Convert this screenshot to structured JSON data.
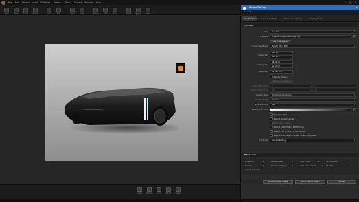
{
  "menu": [
    "File",
    "Edit",
    "Render",
    "Insert",
    "Selection",
    "Pattern",
    "Tools",
    "Shader",
    "Window",
    "Help"
  ],
  "toolbar": [
    "Open",
    "Save",
    "Import",
    "Render",
    "Undo",
    "Redo",
    "Move",
    "Scale",
    "Camera",
    "Light",
    "Env",
    "Output",
    "Render Queue",
    "Region"
  ],
  "dock": [
    "Library",
    "Material",
    "Scene",
    "Project",
    "Render"
  ],
  "panel": {
    "title": "Render Settings",
    "presets": "Presets",
    "tabs": [
      "File Output",
      "General Settings",
      "Raytracing Quality",
      "Display Output"
    ],
    "image_section": "Image",
    "metadata_section": "Metadata",
    "view_label": "View",
    "view_value": "Current",
    "filename_label": "Filename",
    "filename_value": "C:\\render\\snapshots\\image.png",
    "use_time_stamp": "Use Time Stamp",
    "image_size_label": "Image Size/Preset",
    "image_size_value": "SVGA | 800 x 600",
    "image_size_w": "800 px",
    "image_size_h": "600 px",
    "printing_size_w": "28.22 cm",
    "printing_size_h": "21.17 cm",
    "printing_size_label": "Printing Size",
    "image_size_px_label": "Image Size",
    "resolution_label": "Resolution",
    "resolution_value": "72 px / inch",
    "render_region": "Render Region",
    "use_current_region": "Use Current Region",
    "upper_left_corner": "Upper Left Corner",
    "lower_right_corner": "Lower Right Corner",
    "ulc_x": "0",
    "ulc_y": "0",
    "lrc_x": "800",
    "lrc_y": "600",
    "render_mode_label": "Render Mode",
    "render_mode_value": "Full Global Illumination",
    "render_quality_label": "Render Quality",
    "render_quality_value": "Custom",
    "supersampling_label": "Supersampling",
    "supersampling_value": "16x",
    "background_color_label": "Background Color",
    "tonemap_hdr": "Tonemap HDR",
    "export_alpha": "Export Alpha Channel",
    "premultiply_alpha": "Premultiply Alpha",
    "export_hdr": "Export 32Bit HDR or EXR Format",
    "export_exr": "Export EXR in 16-Bit Float Format",
    "export_layers": "Export Multi-Layer EXR/PSD for Render Passes",
    "icc_profile_label": "ICC Profile",
    "icc_profile_value": "Current Settings",
    "stats": {
      "viewpoints_label": "Viewpoints:",
      "viewpoints": "1",
      "renderpasses_label": "Renderpasses:",
      "renderpasses": "0",
      "variant_sets_label": "Variant Sets:",
      "variant_sets": "0",
      "total_renders_label": "Total Renders:",
      "total_renders": "1",
      "frames_label": "Frames:",
      "frames": "1",
      "renderpass_images_label": "Renderpass Images:",
      "renderpass_images": "0",
      "variant_set_renders_label": "Variant Set Renders:",
      "variant_set_renders": "0",
      "total_files_label": "Total Files:",
      "total_files": "1",
      "animation_frames_label": "Animation Frames:",
      "animation_frames": "0"
    },
    "btn_cluster": "Send to Cluster Queue",
    "btn_queue": "Add to Render Queue",
    "btn_render": "Render"
  },
  "colors": {
    "accent": "#2f6db5",
    "background": "#1a1a1a",
    "panel": "#2b2b2b"
  },
  "icons": [
    "render-preview-camera-icon",
    "panel-close-icon",
    "render-settings-icon"
  ]
}
